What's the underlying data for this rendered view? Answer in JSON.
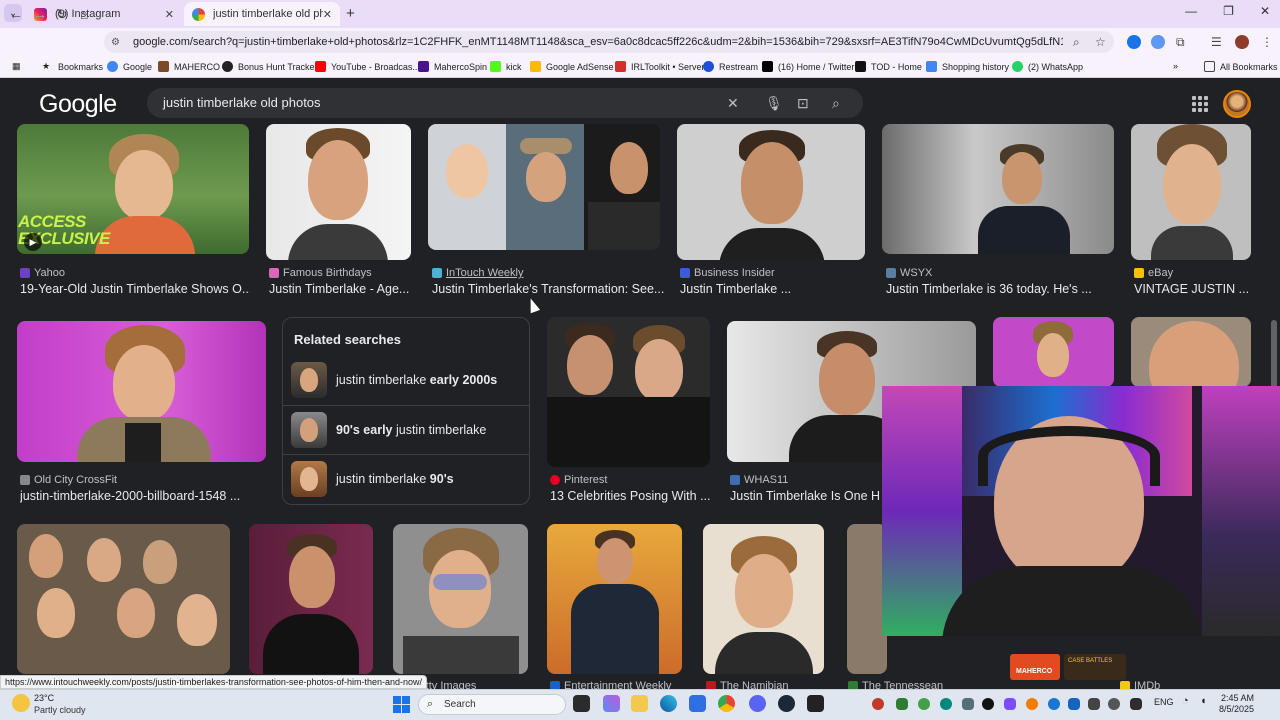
{
  "browser": {
    "tabs": [
      {
        "title": "(9) Instagram",
        "active": false
      },
      {
        "title": "justin timberlake old photos - G",
        "active": true
      }
    ],
    "url": "google.com/search?q=justin+timberlake+old+photos&rlz=1C2FHFK_enMT1148MT1148&sca_esv=6a0c8dcac5ff226c&udm=2&bih=1536&bih=729&sxsrf=AE3TifN79o4CwMDcUvumtQg5dLfN1uRbaA%3A1754354658504&ei=...",
    "bookmarks": [
      "Bookmarks",
      "Google",
      "MAHERCO",
      "Bonus Hunt Tracker",
      "YouTube - Broadcas...",
      "MahercoSpin",
      "kick",
      "Google AdSense",
      "IRLToolkit • Server",
      "Restream",
      "(16) Home / Twitter",
      "TOD - Home",
      "Shopping history",
      "(2) WhatsApp"
    ],
    "all_bookmarks": "All Bookmarks",
    "status_url": "https://www.intouchweekly.com/posts/justin-timberlakes-transformation-see-photos-of-him-then-and-now/"
  },
  "google": {
    "logo": "Google",
    "query": "justin timberlake old photos"
  },
  "results": {
    "row1": [
      {
        "source": "Yahoo",
        "caption": "19-Year-Old Justin Timberlake Shows O...",
        "color": "#6a42c2"
      },
      {
        "source": "Famous Birthdays",
        "caption": "Justin Timberlake - Age...",
        "color": "#d46ab8"
      },
      {
        "source": "InTouch Weekly",
        "caption": "Justin Timberlake's Transformation: See...",
        "color": "#4fb0d6"
      },
      {
        "source": "Business Insider",
        "caption": "Justin Timberlake ...",
        "color": "#3b5bdb"
      },
      {
        "source": "WSYX",
        "caption": "Justin Timberlake is 36 today. He's ...",
        "color": "#5a7fa3"
      },
      {
        "source": "eBay",
        "caption": "VINTAGE JUSTIN ...",
        "color": "#f5c400"
      }
    ],
    "row2": [
      {
        "source": "Old City CrossFit",
        "caption": "justin-timberlake-2000-billboard-1548 ...",
        "color": "#888888"
      },
      {
        "source": "Pinterest",
        "caption": "13 Celebrities Posing With ...",
        "color": "#e60023"
      },
      {
        "source": "WHAS11",
        "caption": "Justin Timberlake Is One Ho",
        "color": "#3a6db5"
      }
    ],
    "row3_sources": [
      {
        "source": "Getty Images",
        "color": "#444444"
      },
      {
        "source": "Entertainment Weekly",
        "color": "#1565c0"
      },
      {
        "source": "The Namibian",
        "color": "#b71c1c"
      },
      {
        "source": "The Tennessean",
        "color": "#2e7d32"
      },
      {
        "source": "IMDb",
        "color": "#f5c518"
      }
    ],
    "thumb_overlay_text": "ACCESS EXCLUSIVE"
  },
  "related": {
    "title": "Related searches",
    "items": [
      {
        "plain": "justin timberlake ",
        "bold": "early 2000s",
        "bold_first": false
      },
      {
        "plain": " justin timberlake",
        "bold": "90's early",
        "bold_first": true
      },
      {
        "plain": "justin timberlake ",
        "bold": "90's",
        "bold_first": false
      }
    ]
  },
  "overlay": {
    "badge_left": "MAHERCO",
    "badge_right": "CASE BATTLES"
  },
  "taskbar": {
    "temperature": "23°C",
    "weather": "Partly cloudy",
    "search_placeholder": "Search",
    "lang": "ENG",
    "time": "2:45 AM",
    "date": "8/5/2025"
  },
  "window_controls": [
    "—",
    "❐",
    "✕"
  ]
}
